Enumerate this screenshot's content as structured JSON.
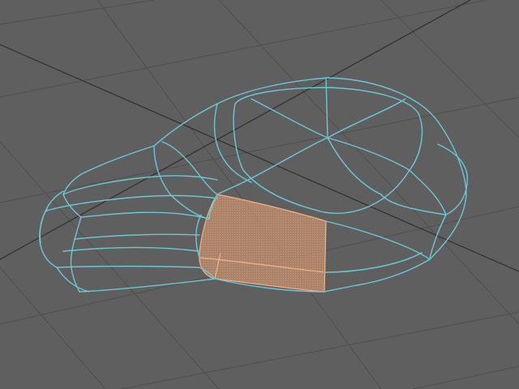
{
  "viewport": {
    "background": "#5f5f5f",
    "grid_color": "#4f4f4f",
    "axis_color": "#2f2f2f"
  },
  "mesh": {
    "wire_color": "#6cc7d6",
    "selected_face_fill": "#c9906a",
    "selected_face_edge": "#f0b48a",
    "selected_face_opacity": 0.75
  }
}
